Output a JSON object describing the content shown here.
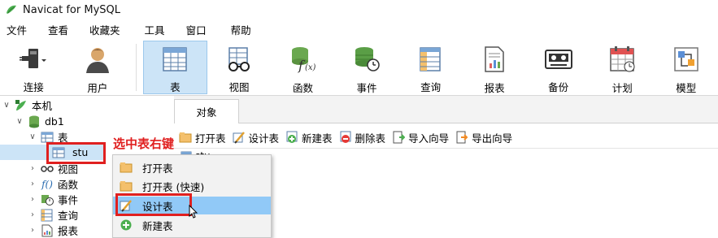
{
  "window": {
    "title": "Navicat for MySQL"
  },
  "menu": [
    "文件",
    "查看",
    "收藏夹",
    "工具",
    "窗口",
    "帮助"
  ],
  "toolbar": [
    {
      "label": "连接",
      "icon": "plug-icon"
    },
    {
      "label": "用户",
      "icon": "user-icon"
    },
    {
      "label": "表",
      "icon": "table-icon",
      "active": true
    },
    {
      "label": "视图",
      "icon": "view-icon"
    },
    {
      "label": "函数",
      "icon": "function-icon"
    },
    {
      "label": "事件",
      "icon": "event-icon"
    },
    {
      "label": "查询",
      "icon": "query-icon"
    },
    {
      "label": "报表",
      "icon": "report-icon"
    },
    {
      "label": "备份",
      "icon": "backup-icon"
    },
    {
      "label": "计划",
      "icon": "schedule-icon"
    },
    {
      "label": "模型",
      "icon": "model-icon"
    }
  ],
  "tree": {
    "connection": "本机",
    "database": "db1",
    "tables_folder": "表",
    "selected_table": "stu",
    "views": "视图",
    "functions": "函数",
    "events": "事件",
    "queries": "查询",
    "reports": "报表"
  },
  "tabs": {
    "objects": "对象"
  },
  "object_toolbar": [
    "打开表",
    "设计表",
    "新建表",
    "删除表",
    "导入向导",
    "导出向导"
  ],
  "object_list": {
    "partial_item": "stu"
  },
  "context_menu": {
    "items": [
      "打开表",
      "打开表 (快速)",
      "设计表",
      "新建表"
    ],
    "highlighted": "设计表"
  },
  "annotation": {
    "text": "选中表右键",
    "color": "#e02020"
  },
  "colors": {
    "active": "#cce4f7",
    "menu_highlight": "#91c9f7"
  }
}
